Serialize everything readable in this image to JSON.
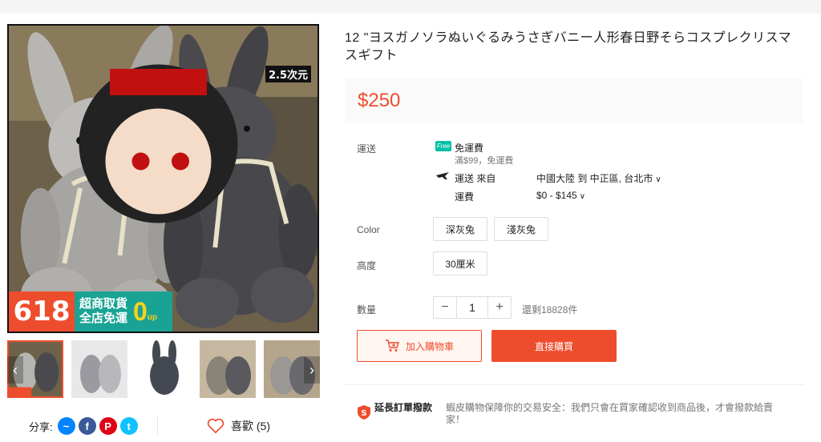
{
  "product": {
    "title": "12 \"ヨスガノソラぬいぐるみうさぎバニー人形春日野そらコスプレクリスマスギフト",
    "price": "$250",
    "promo": {
      "badge": "618",
      "line1": "超商取貨",
      "line2": "全店免運",
      "zero": "0",
      "up": "up"
    },
    "brand_badge": "2.5次元"
  },
  "shipping": {
    "label": "運送",
    "free_tag": "Free",
    "free_title": "免運費",
    "free_note": "滿$99，免運費",
    "from_label": "運送 來自",
    "from_value": "中國大陸 到 中正區, 台北市",
    "fee_label": "運費",
    "fee_value": "$0 - $145"
  },
  "options": {
    "color_label": "Color",
    "colors": [
      "深灰兔",
      "淺灰兔"
    ],
    "height_label": "高度",
    "heights": [
      "30厘米"
    ]
  },
  "quantity": {
    "label": "數量",
    "value": "1",
    "minus": "−",
    "plus": "+",
    "stock": "還剩18828件"
  },
  "actions": {
    "add_to_cart": "加入購物車",
    "buy_now": "直接購買"
  },
  "guarantee": {
    "title": "延長訂單撥款",
    "desc": "蝦皮購物保障你的交易安全：我們只會在買家確認收到商品後，才會撥款給賣家！"
  },
  "share": {
    "label": "分享:",
    "icons": [
      "messenger-icon",
      "facebook-icon",
      "pinterest-icon",
      "twitter-icon"
    ]
  },
  "like": {
    "label": "喜歡 (5)"
  },
  "thumb_nav": {
    "prev": "‹",
    "next": "›"
  },
  "colors": {
    "accent": "#ee4d2d",
    "teal": "#1aa394",
    "free": "#00bfa5"
  }
}
